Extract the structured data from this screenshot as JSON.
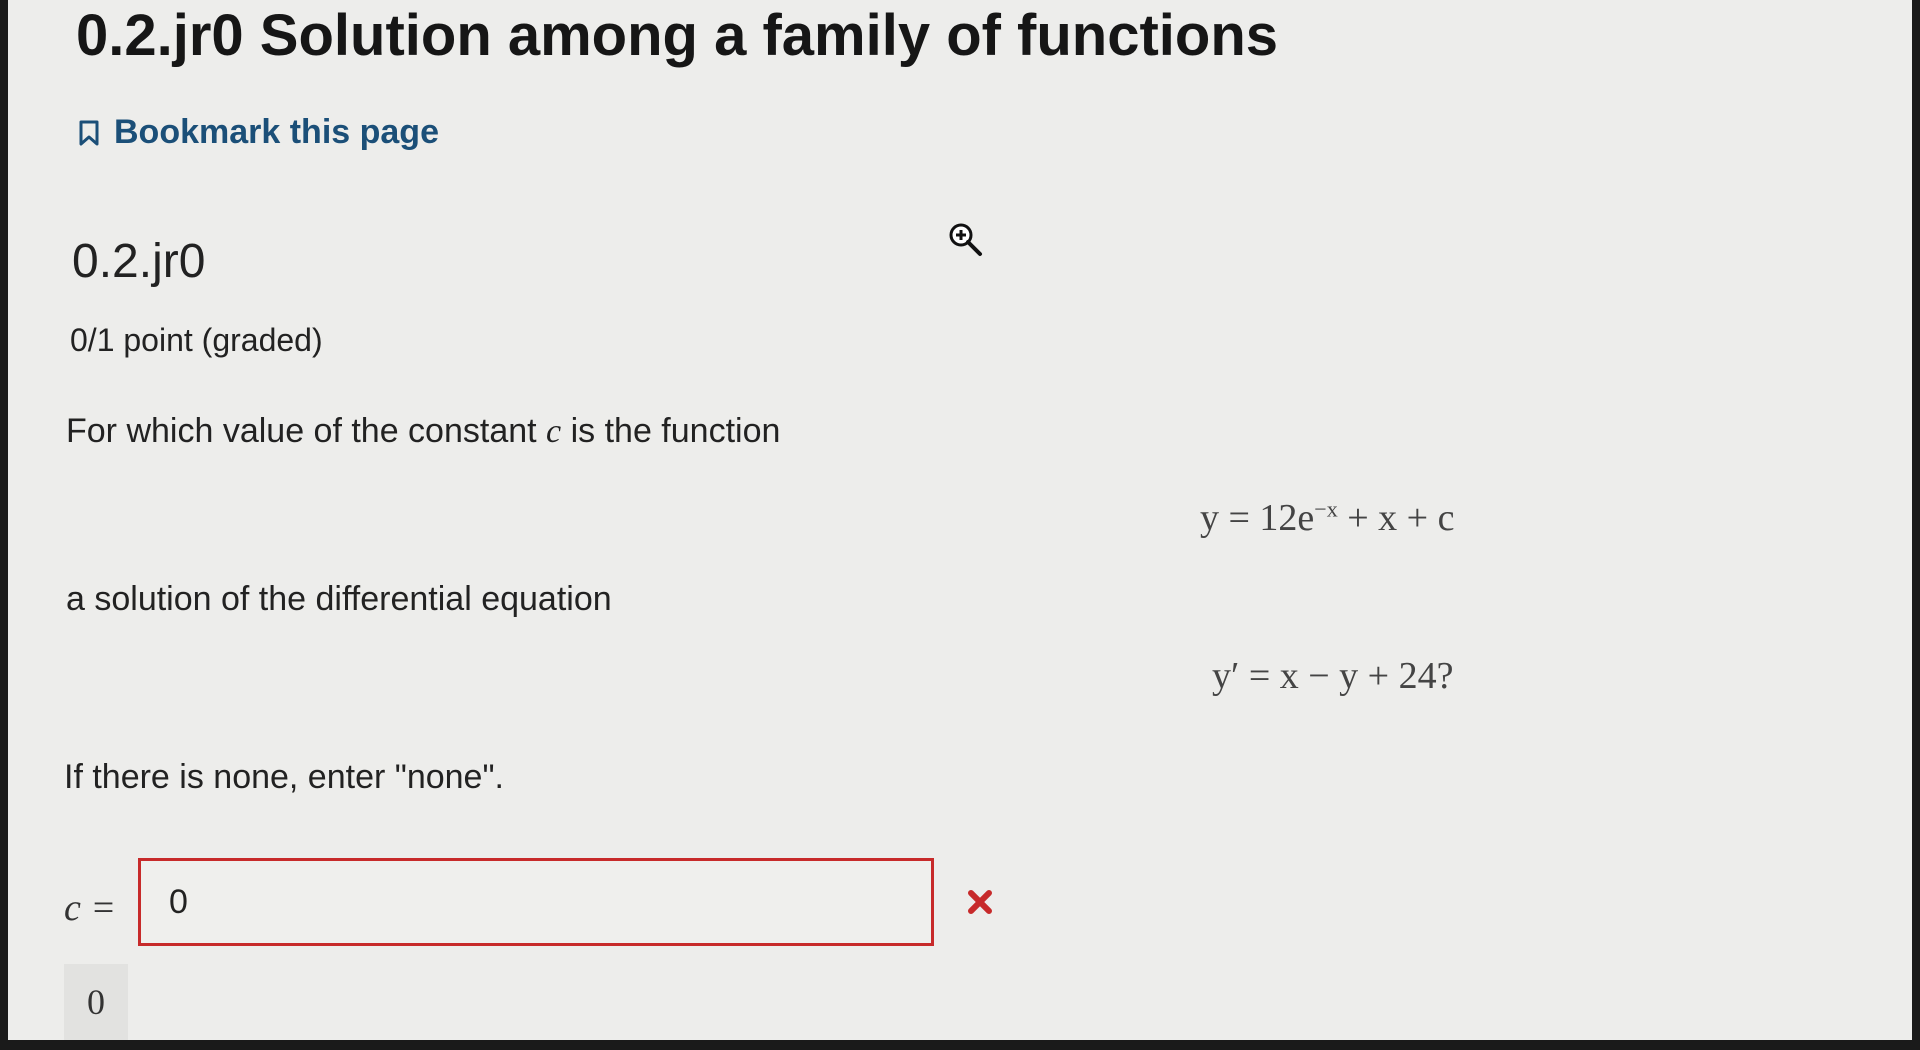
{
  "unit": {
    "title": "0.2.jr0 Solution among a family of functions",
    "bookmark_label": "Bookmark this page"
  },
  "problem": {
    "title": "0.2.jr0",
    "points": "0/1 point (graded)",
    "question_start": "For which value of the constant ",
    "question_const": "c",
    "question_end": " is the function",
    "equation1": "y = 12e",
    "equation1_exponent": "−x",
    "equation1_tail": " + x + c",
    "question_mid": "a solution of the differential equation",
    "equation2": "y′ = x − y + 24?",
    "question_none": "If there is none, enter \"none\".",
    "answer_label": "c =",
    "answer_value": "0",
    "answer_status_icon": "incorrect-x-icon",
    "answer_preview": "0"
  },
  "colors": {
    "background": "#ededeb",
    "link": "#1b4f78",
    "error": "#c72a2a"
  }
}
